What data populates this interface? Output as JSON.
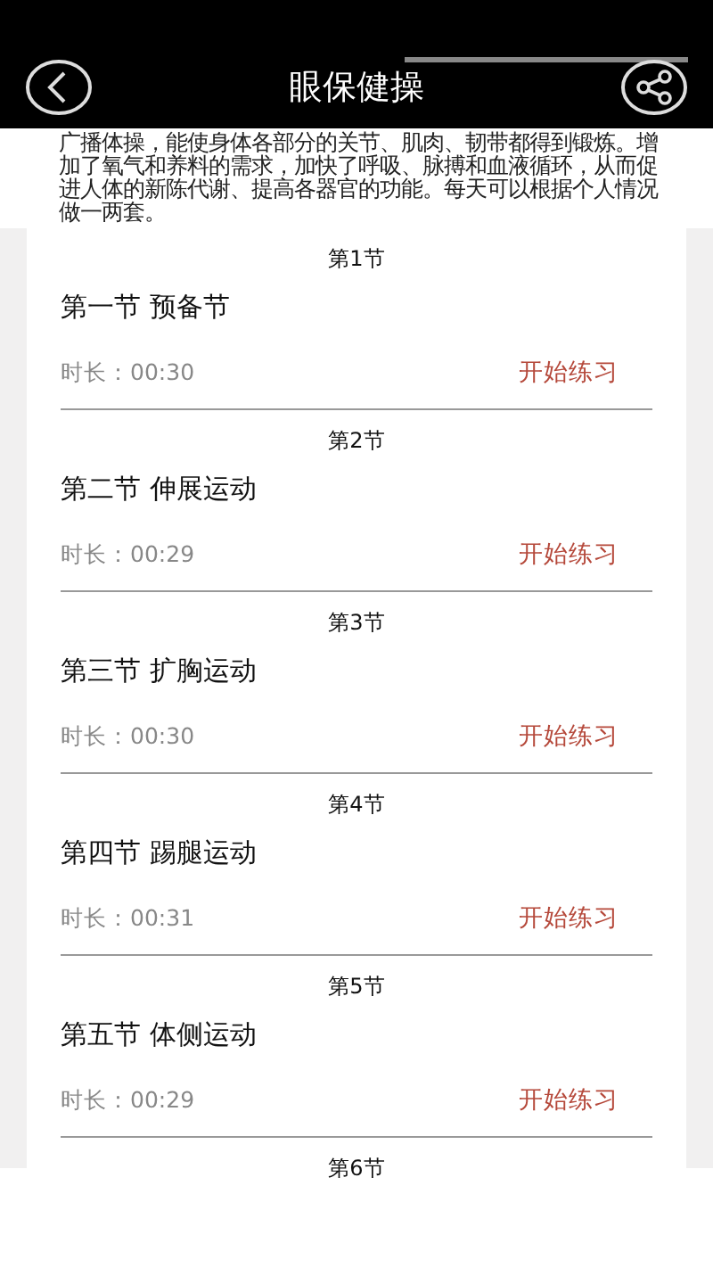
{
  "header": {
    "title": "眼保健操"
  },
  "intro": "广播体操，能使身体各部分的关节、肌肉、韧带都得到锻炼。增加了氧气和养料的需求，加快了呼吸、脉搏和血液循环，从而促进人体的新陈代谢、提高各器官的功能。每天可以根据个人情况做一两套。",
  "sections": [
    {
      "label": "第1节",
      "title": "第一节 预备节",
      "duration": "时长：00:30",
      "action": "开始练习"
    },
    {
      "label": "第2节",
      "title": "第二节 伸展运动",
      "duration": "时长：00:29",
      "action": "开始练习"
    },
    {
      "label": "第3节",
      "title": "第三节 扩胸运动",
      "duration": "时长：00:30",
      "action": "开始练习"
    },
    {
      "label": "第4节",
      "title": "第四节 踢腿运动",
      "duration": "时长：00:31",
      "action": "开始练习"
    },
    {
      "label": "第5节",
      "title": "第五节 体侧运动",
      "duration": "时长：00:29",
      "action": "开始练习"
    },
    {
      "label": "第6节"
    }
  ]
}
